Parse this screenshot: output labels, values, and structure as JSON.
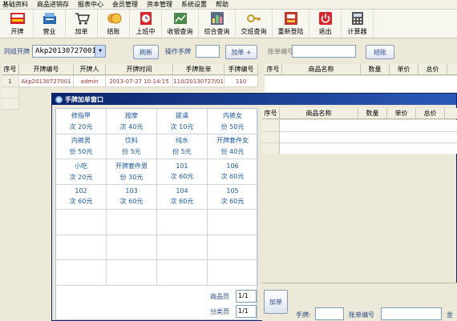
{
  "menu": [
    "基础资料",
    "商品进销存",
    "报表中心",
    "会员管理",
    "资本管理",
    "系统设置",
    "帮助"
  ],
  "toolbar": {
    "buttons": [
      {
        "label": "开牌",
        "icon": "sale-icon"
      },
      {
        "label": "营业",
        "icon": "register-icon"
      },
      {
        "label": "加单",
        "icon": "cart-icon"
      },
      {
        "label": "结账",
        "icon": "checkout-icon"
      },
      {
        "label": "上班中",
        "icon": "clock-icon"
      },
      {
        "label": "收银查询",
        "icon": "cashier-icon"
      },
      {
        "label": "综合查询",
        "icon": "chart-icon"
      },
      {
        "label": "交班查询",
        "icon": "key-icon"
      },
      {
        "label": "重新登陆",
        "icon": "relogin-icon"
      },
      {
        "label": "退出",
        "icon": "power-icon"
      },
      {
        "label": "计算器",
        "icon": "calculator-icon"
      }
    ]
  },
  "filter": {
    "group_label": "同组开牌",
    "group_value": "Akp20130727001",
    "refresh_label": "刷新",
    "operator_label": "操作手牌",
    "operator_value": "",
    "add_label": "加单 +",
    "bill_label": "账单编号",
    "bill_value": "",
    "checkout_label": "结账"
  },
  "main_table": {
    "headers": [
      "序号",
      "开牌编号",
      "开牌人",
      "开牌时间",
      "手牌账单",
      "手牌编号"
    ],
    "rows": [
      [
        "1",
        "Akp20130727001",
        "admin",
        "2013-07-27 10:14:15",
        "110/20130727/01",
        "110"
      ]
    ]
  },
  "right_table": {
    "headers": [
      "序号",
      "商品名称",
      "数量",
      "单价",
      "总价"
    ]
  },
  "dialog": {
    "title": "手牌加单窗口",
    "items": [
      {
        "name": "修指甲",
        "price": "次 20元"
      },
      {
        "name": "按摩",
        "price": "次 40元"
      },
      {
        "name": "搓澡",
        "price": "次 10元"
      },
      {
        "name": "内裤女",
        "price": "份 50元"
      },
      {
        "name": "内裤男",
        "price": "份 50元"
      },
      {
        "name": "饮料",
        "price": "份 5元"
      },
      {
        "name": "纯水",
        "price": "份 5元"
      },
      {
        "name": "开牌套件女",
        "price": "份 40元"
      },
      {
        "name": "小吃",
        "price": "次 20元"
      },
      {
        "name": "开牌套件男",
        "price": "份 30元"
      },
      {
        "name": "101",
        "price": "次 60元"
      },
      {
        "name": "106",
        "price": "次 60元"
      },
      {
        "name": "102",
        "price": "次 60元"
      },
      {
        "name": "103",
        "price": "次 60元"
      },
      {
        "name": "104",
        "price": "次 60元"
      },
      {
        "name": "105",
        "price": "次 60元"
      }
    ],
    "product_page_label": "商品页",
    "product_page_value": "1/1",
    "category_page_label": "分类页",
    "category_page_value": "1/1",
    "right_headers": [
      "序号",
      "商品名称",
      "数量",
      "单价",
      "总价"
    ],
    "add_label": "加单",
    "hand_label": "手牌:",
    "hand_value": "",
    "bill_label": "账单编号",
    "bill_value": "",
    "total_label": "金"
  }
}
